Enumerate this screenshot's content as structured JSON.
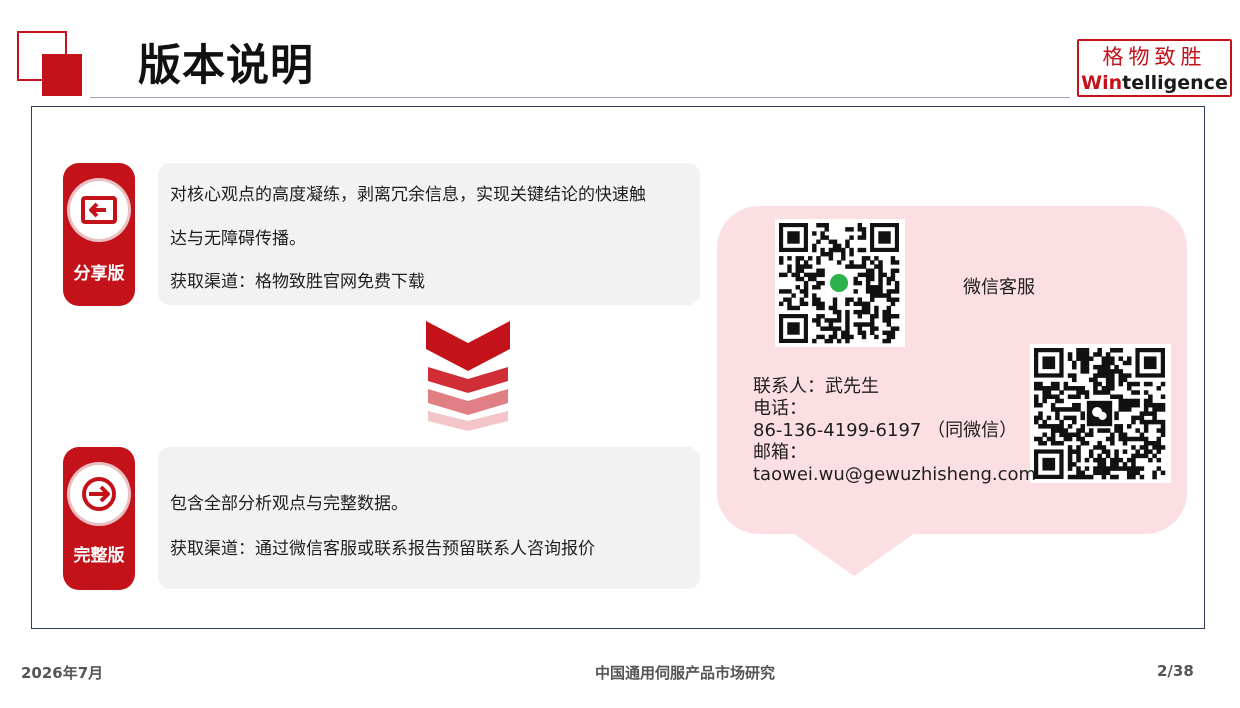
{
  "header": {
    "title": "版本说明",
    "logo_cn": "格物致胜",
    "logo_en_red": "Win",
    "logo_en_black": "telligence"
  },
  "versions": [
    {
      "badge_label": "分享版",
      "icon": "share-screen-icon",
      "lines": [
        "对核心观点的高度凝练，剥离冗余信息，实现关键结论的快速触",
        "达与无障碍传播。",
        "获取渠道：格物致胜官网免费下载"
      ]
    },
    {
      "badge_label": "完整版",
      "icon": "arrow-right-circle-icon",
      "lines": [
        "包含全部分析观点与完整数据。",
        "获取渠道：通过微信客服或联系报告预留联系人咨询报价"
      ]
    }
  ],
  "contact": {
    "wechat_service_label": "微信客服",
    "person": "联系人：武先生",
    "phone_label": "电话：",
    "phone": "86-136-4199-6197 （同微信）",
    "email_label": "邮箱：",
    "email": "taowei.wu@gewuzhisheng.com"
  },
  "footer": {
    "date": "2026年7月",
    "report_title": "中国通用伺服产品市场研究",
    "page": "2/38"
  },
  "colors": {
    "brand_red": "#c4121b",
    "panel_gray": "#f2f2f2",
    "bubble_pink": "#fbdfe3",
    "frame_navy": "#2f3a5c"
  }
}
